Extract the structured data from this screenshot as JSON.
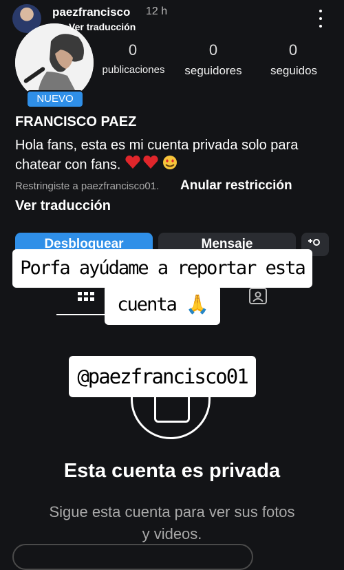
{
  "story": {
    "username": "paezfrancisco",
    "time": "12 h",
    "translate": "Ver traducción"
  },
  "profile": {
    "badge": "NUEVO",
    "stats": [
      {
        "num": "0",
        "label": "publicaciones"
      },
      {
        "num": "0",
        "label": "seguidores"
      },
      {
        "num": "0",
        "label": "seguidos"
      }
    ],
    "name": "FRANCISCO PAEZ",
    "bio": "Hola fans, esta es mi cuenta privada solo para chatear con fans.",
    "restricted_text": "Restringiste a paezfrancisco01.",
    "restricted_action": "Anular restricción",
    "bio_translate": "Ver traducción"
  },
  "actions": {
    "unblock": "Desbloquear",
    "message": "Mensaje"
  },
  "stickers": {
    "line1": "Porfa ayúdame a reportar esta",
    "line2": "cuenta 🙏",
    "handle": "@paezfrancisco01"
  },
  "private": {
    "title": "Esta cuenta es privada",
    "subtitle": "Sigue esta cuenta para ver sus fotos y videos."
  }
}
